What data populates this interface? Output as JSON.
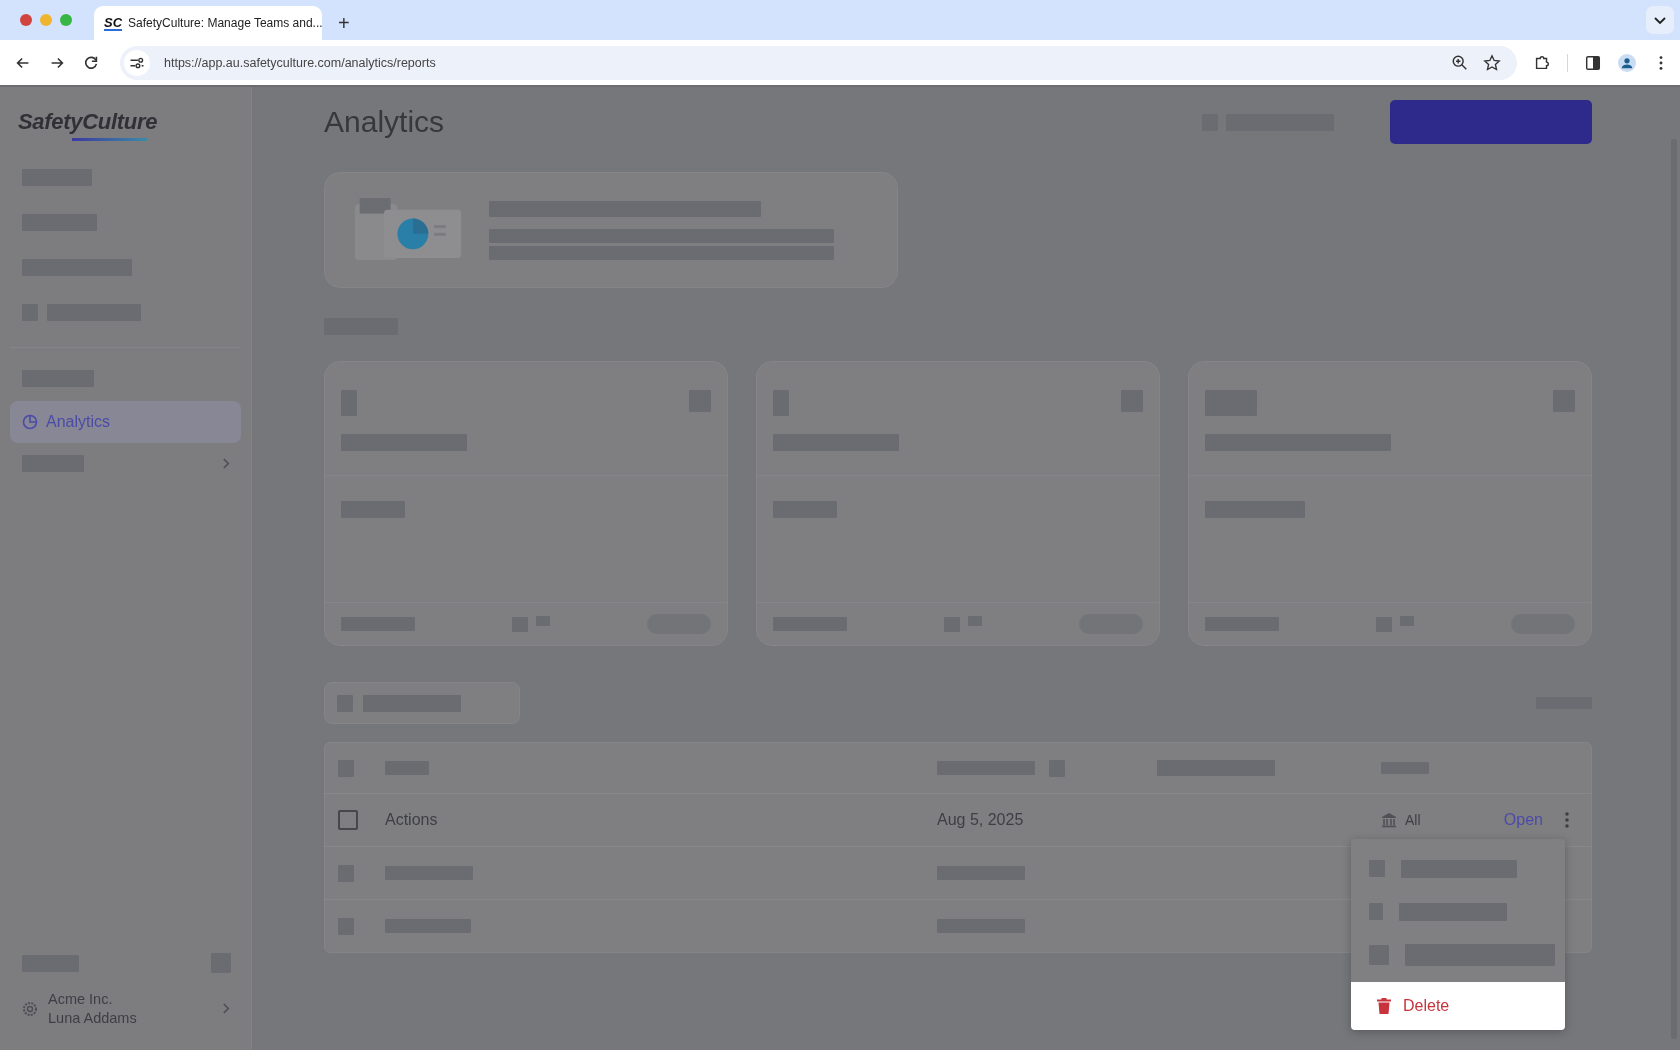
{
  "browser": {
    "favicon_text": "SC",
    "tab_title": "SafetyCulture: Manage Teams and...",
    "new_tab": "+",
    "url": "https://app.au.safetyculture.com/analytics/reports"
  },
  "sidebar": {
    "logo": "SafetyCulture",
    "items": [
      {
        "label": "Analytics",
        "selected": true
      }
    ],
    "account": {
      "org": "Acme Inc.",
      "user": "Luna Addams"
    }
  },
  "page": {
    "title": "Analytics"
  },
  "table": {
    "rows": [
      {
        "name": "Actions",
        "date": "Aug 5, 2025",
        "access": "All",
        "action": "Open",
        "checked": false
      }
    ]
  },
  "menu": {
    "items": [
      {
        "label": "Delete",
        "kind": "danger"
      }
    ]
  }
}
